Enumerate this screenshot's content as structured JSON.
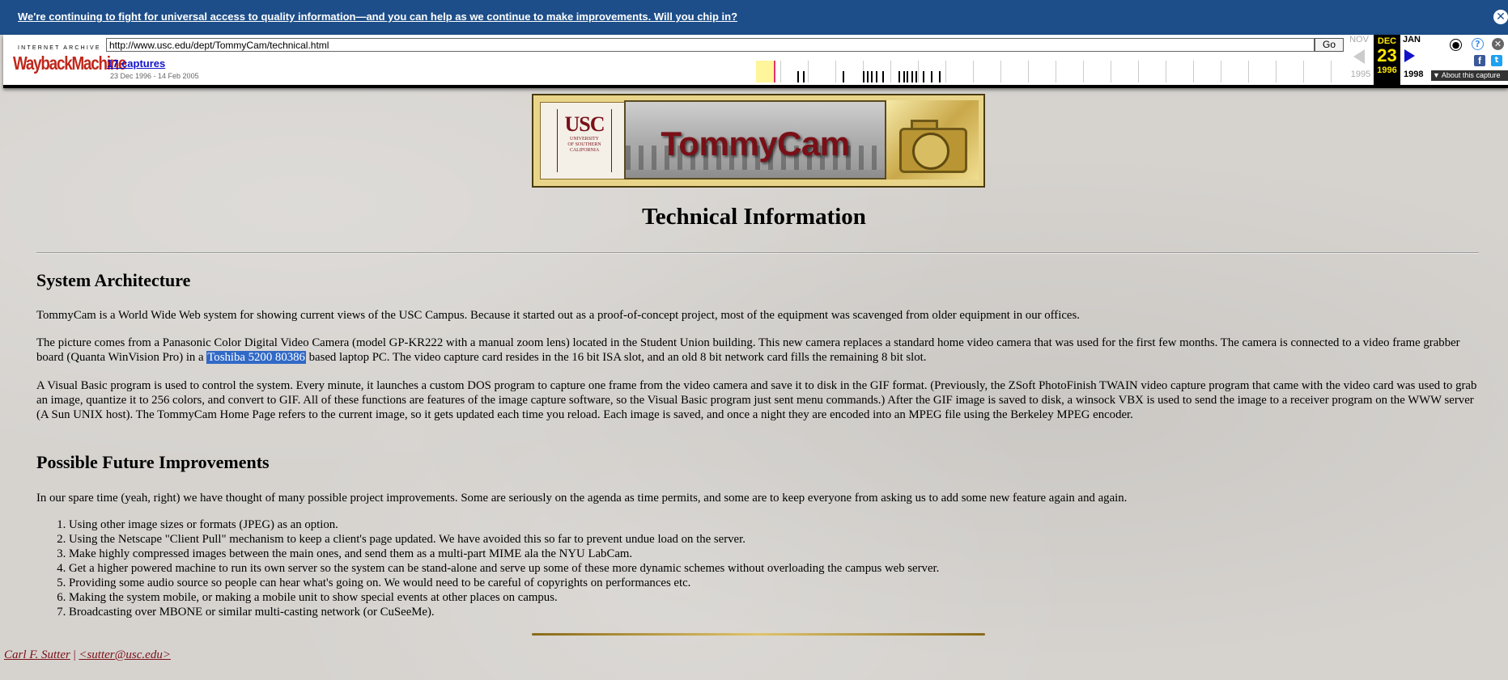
{
  "banner": {
    "message": "We're continuing to fight for universal access to quality information—and you can help as we continue to make improvements. Will you chip in?",
    "close_glyph": "✕"
  },
  "wayback": {
    "logo_top": "INTERNET ARCHIVE",
    "logo_main": "WaybackMachine",
    "url": "http://www.usc.edu/dept/TommyCam/technical.html",
    "go_label": "Go",
    "captures_label": "17 captures",
    "capture_range": "23 Dec 1996 - 14 Feb 2005",
    "prev_month": "NOV",
    "current_month": "DEC",
    "current_day": "23",
    "current_year": "1996",
    "next_month": "JAN",
    "prev_year": "1995",
    "next_year": "1998",
    "about_label": "▼ About this capture",
    "facebook_glyph": "f",
    "twitter_glyph": "t",
    "help_glyph": "?",
    "close_glyph": "✕",
    "user_glyph": "●"
  },
  "header_image": {
    "usc_big": "USC",
    "usc_line1": "UNIVERSITY",
    "usc_line2": "OF SOUTHERN",
    "usc_line3": "CALIFORNIA",
    "title": "TommyCam"
  },
  "page": {
    "title": "Technical Information",
    "section1_heading": "System Architecture",
    "p1": "TommyCam is a World Wide Web system for showing current views of the USC Campus. Because it started out as a proof-of-concept project, most of the equipment was scavenged from older equipment in our offices.",
    "p2_before": "The picture comes from a Panasonic Color Digital Video Camera (model GP-KR222 with a manual zoom lens) located in the Student Union building. This new camera replaces a standard home video camera that was used for the first few months. The camera is connected to a video frame grabber board (Quanta WinVision Pro) in a ",
    "p2_highlight": "Toshiba 5200 80386",
    "p2_after": " based laptop PC. The video capture card resides in the 16 bit ISA slot, and an old 8 bit network card fills the remaining 8 bit slot.",
    "p3": "A Visual Basic program is used to control the system. Every minute, it launches a custom DOS program to capture one frame from the video camera and save it to disk in the GIF format. (Previously, the ZSoft PhotoFinish TWAIN video capture program that came with the video card was used to grab an image, quantize it to 256 colors, and convert to GIF. All of these functions are features of the image capture software, so the Visual Basic program just sent menu commands.) After the GIF image is saved to disk, a winsock VBX is used to send the image to a receiver program on the WWW server (A Sun UNIX host). The TommyCam Home Page refers to the current image, so it gets updated each time you reload. Each image is saved, and once a night they are encoded into an MPEG file using the Berkeley MPEG encoder.",
    "section2_heading": "Possible Future Improvements",
    "p4": "In our spare time (yeah, right) we have thought of many possible project improvements. Some are seriously on the agenda as time permits, and some are to keep everyone from asking us to add some new feature again and again.",
    "improvements": [
      "Using other image sizes or formats (JPEG) as an option.",
      "Using the Netscape \"Client Pull\" mechanism to keep a client's page updated. We have avoided this so far to prevent undue load on the server.",
      "Make highly compressed images between the main ones, and send them as a multi-part MIME ala the NYU LabCam.",
      "Get a higher powered machine to run its own server so the system can be stand-alone and serve up some of these more dynamic schemes without overloading the campus web server.",
      "Providing some audio source so people can hear what's going on. We would need to be careful of copyrights on performances etc.",
      "Making the system mobile, or making a mobile unit to show special events at other places on campus.",
      "Broadcasting over MBONE or similar multi-casting network (or CuSeeMe)."
    ]
  },
  "footer": {
    "author": "Carl F. Sutter",
    "separator": "|",
    "email": "<sutter@usc.edu>"
  },
  "colors": {
    "banner_bg": "#1d4e89",
    "usc_cardinal": "#7a1017",
    "selection": "#3169c6",
    "wayback_red": "#c0271b",
    "current_date_yellow": "#ffe900"
  }
}
